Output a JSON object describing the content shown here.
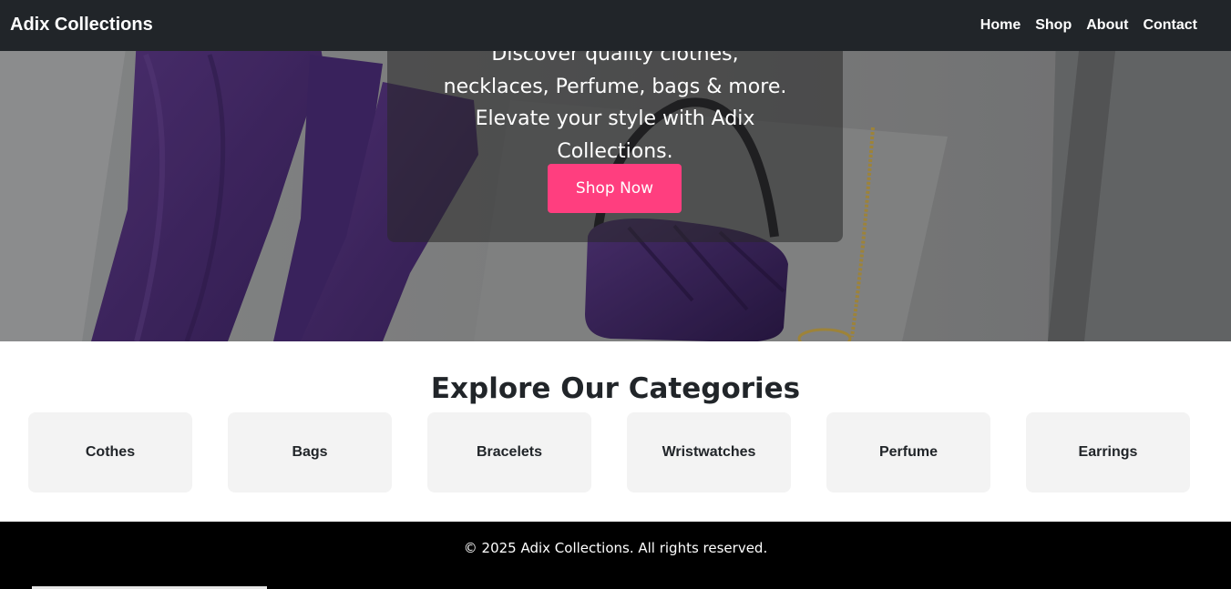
{
  "navbar": {
    "brand": "Adix Collections",
    "links": [
      {
        "label": "Home"
      },
      {
        "label": "Shop"
      },
      {
        "label": "About"
      },
      {
        "label": "Contact"
      }
    ]
  },
  "hero": {
    "tagline": "Discover quality clothes, necklaces, Perfume, bags & more. Elevate your style with Adix Collections.",
    "cta_label": "Shop Now",
    "cta_color": "#ff3e7f"
  },
  "categories": {
    "title": "Explore Our Categories",
    "items": [
      {
        "label": "Cothes"
      },
      {
        "label": "Bags"
      },
      {
        "label": "Bracelets"
      },
      {
        "label": "Wristwatches"
      },
      {
        "label": "Perfume"
      },
      {
        "label": "Earrings"
      }
    ]
  },
  "footer": {
    "copyright": "© 2025 Adix Collections. All rights reserved."
  }
}
